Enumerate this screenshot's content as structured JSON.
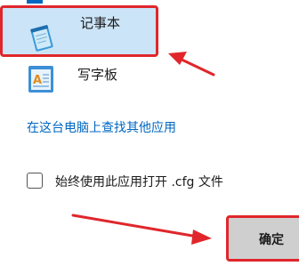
{
  "apps": [
    {
      "name": "记事本",
      "icon": "notepad-icon",
      "selected": true
    },
    {
      "name": "写字板",
      "icon": "wordpad-icon",
      "selected": false
    }
  ],
  "more_apps_link": "在这台电脑上查找其他应用",
  "always_use": {
    "label": "始终使用此应用打开 .cfg 文件",
    "checked": false
  },
  "ok_button": {
    "label": "确定"
  },
  "colors": {
    "selection": "#cce4f7",
    "accent": "#0067c0",
    "highlight": "#e0262b",
    "button": "#cfcfcf"
  }
}
